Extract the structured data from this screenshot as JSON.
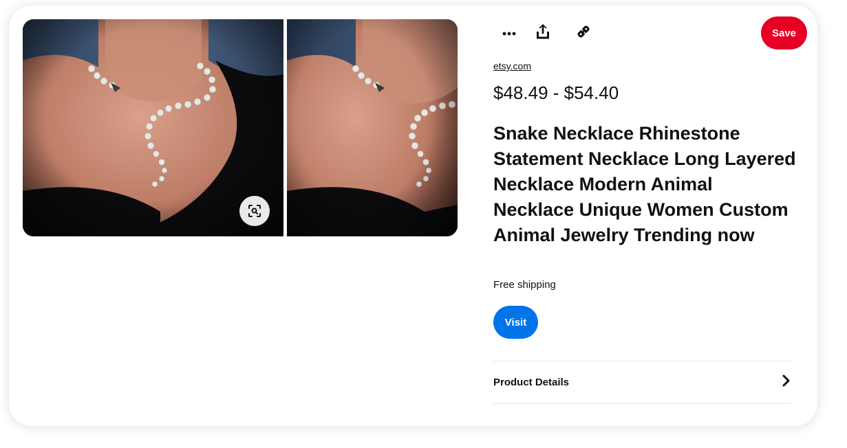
{
  "toolbar": {
    "more_icon": "more-horizontal-icon",
    "share_icon": "share-upload-icon",
    "link_icon": "link-icon",
    "save_label": "Save"
  },
  "media": {
    "lens_icon": "visual-search-icon"
  },
  "product": {
    "source": "etsy.com",
    "price": "$48.49 - $54.40",
    "title": "Snake Necklace Rhinestone Statement Necklace Long Layered Necklace Modern Animal Necklace Unique Women Custom Animal Jewelry Trending now",
    "shipping": "Free shipping",
    "visit_label": "Visit",
    "details_label": "Product Details",
    "details_icon": "chevron-right-icon"
  },
  "colors": {
    "save": "#e60023",
    "visit": "#0074e8"
  }
}
